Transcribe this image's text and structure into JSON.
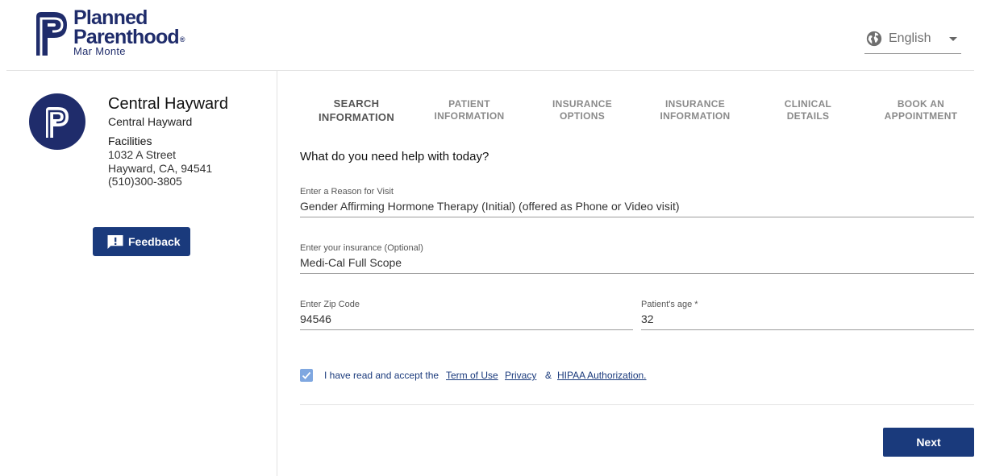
{
  "header": {
    "logo": {
      "line1": "Planned",
      "line2": "Parenthood",
      "registered": "®",
      "sub": "Mar Monte"
    },
    "language": {
      "selected": "English",
      "icon": "globe-icon"
    }
  },
  "sidebar": {
    "clinic_name": "Central Hayward",
    "clinic_subtitle": "Central Hayward",
    "facilities_label": "Facilities",
    "address_line1": "1032 A Street",
    "address_line2": "Hayward, CA, 94541",
    "phone": "(510)300-3805",
    "feedback_label": "Feedback",
    "feedback_icon": "feedback-icon"
  },
  "steps": [
    {
      "line1": "SEARCH",
      "line2": "INFORMATION",
      "active": true
    },
    {
      "line1": "PATIENT",
      "line2": "INFORMATION",
      "active": false
    },
    {
      "line1": "INSURANCE",
      "line2": "OPTIONS",
      "active": false
    },
    {
      "line1": "INSURANCE",
      "line2": "INFORMATION",
      "active": false
    },
    {
      "line1": "CLINICAL",
      "line2": "DETAILS",
      "active": false
    },
    {
      "line1": "BOOK AN",
      "line2": "APPOINTMENT",
      "active": false
    }
  ],
  "form": {
    "question": "What do you need help with today?",
    "reason": {
      "label": "Enter a Reason for Visit",
      "value": "Gender Affirming Hormone Therapy (Initial) (offered as Phone or Video visit)"
    },
    "insurance": {
      "label": "Enter your insurance (Optional)",
      "value": "Medi-Cal Full Scope"
    },
    "zip": {
      "label": "Enter Zip Code",
      "value": "94546"
    },
    "age": {
      "label": "Patient's age *",
      "value": "32"
    },
    "consent": {
      "checked": true,
      "text": "I have read and accept the",
      "terms": "Term of Use",
      "privacy": "Privacy",
      "amp": "&",
      "hipaa": "HIPAA Authorization."
    },
    "next_label": "Next"
  },
  "colors": {
    "brand_navy": "#1f2c6b",
    "button_blue": "#1a3a7c",
    "checkbox_blue": "#7fa7e0"
  }
}
